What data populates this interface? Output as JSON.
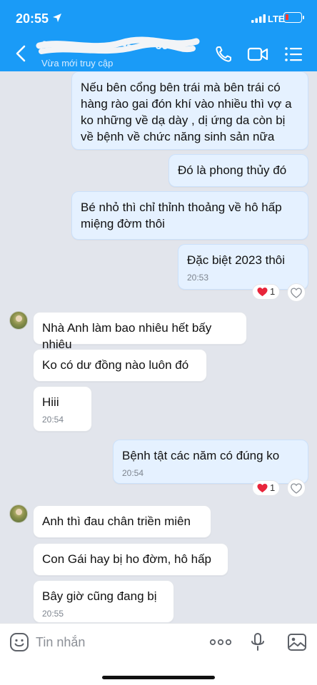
{
  "status_bar": {
    "time": "20:55",
    "network": "LTE"
  },
  "header": {
    "contact_name": "A~~~~~~~~~~~~~~~69",
    "last_seen": "Vừa mới truy cập",
    "icons": [
      "back-icon",
      "call-icon",
      "video-call-icon",
      "menu-icon"
    ]
  },
  "messages": [
    {
      "dir": "sent",
      "text": "Nếu bên cổng bên trái mà bên trái có hàng rào gai đón khí vào nhiều thì vợ a ko những về dạ dày , dị ứng da còn bị về bệnh về chức năng sinh sản nữa"
    },
    {
      "dir": "sent",
      "text": "Đó là phong thủy đó"
    },
    {
      "dir": "sent",
      "text": "Bé nhỏ thì chỉ thỉnh thoảng về hô hấp miệng đờm thôi"
    },
    {
      "dir": "sent",
      "text": "Đặc biệt 2023 thôi",
      "time": "20:53",
      "reaction_count": "1"
    },
    {
      "dir": "recv",
      "text": "Nhà Anh làm bao nhiêu hết bấy nhiêu"
    },
    {
      "dir": "recv",
      "text": "Ko có dư đồng nào luôn đó"
    },
    {
      "dir": "recv",
      "text": "Hiii",
      "time": "20:54"
    },
    {
      "dir": "sent",
      "text": "Bệnh tật các năm  có đúng ko",
      "time": "20:54",
      "reaction_count": "1"
    },
    {
      "dir": "recv",
      "text": "Anh thì đau chân triền miên"
    },
    {
      "dir": "recv",
      "text": "Con Gái hay bị ho đờm, hô hấp"
    },
    {
      "dir": "recv",
      "text": "Bây giờ cũng đang bị",
      "time": "20:55"
    }
  ],
  "input_bar": {
    "placeholder": "Tin nhắn",
    "icons": [
      "sticker-icon",
      "more-icon",
      "mic-icon",
      "image-icon"
    ]
  },
  "colors": {
    "header_bg": "#1a9bf7",
    "sent_bubble": "#e5f1ff",
    "recv_bubble": "#ffffff",
    "chat_bg": "#e2e5ec",
    "heart": "#e8253a"
  }
}
